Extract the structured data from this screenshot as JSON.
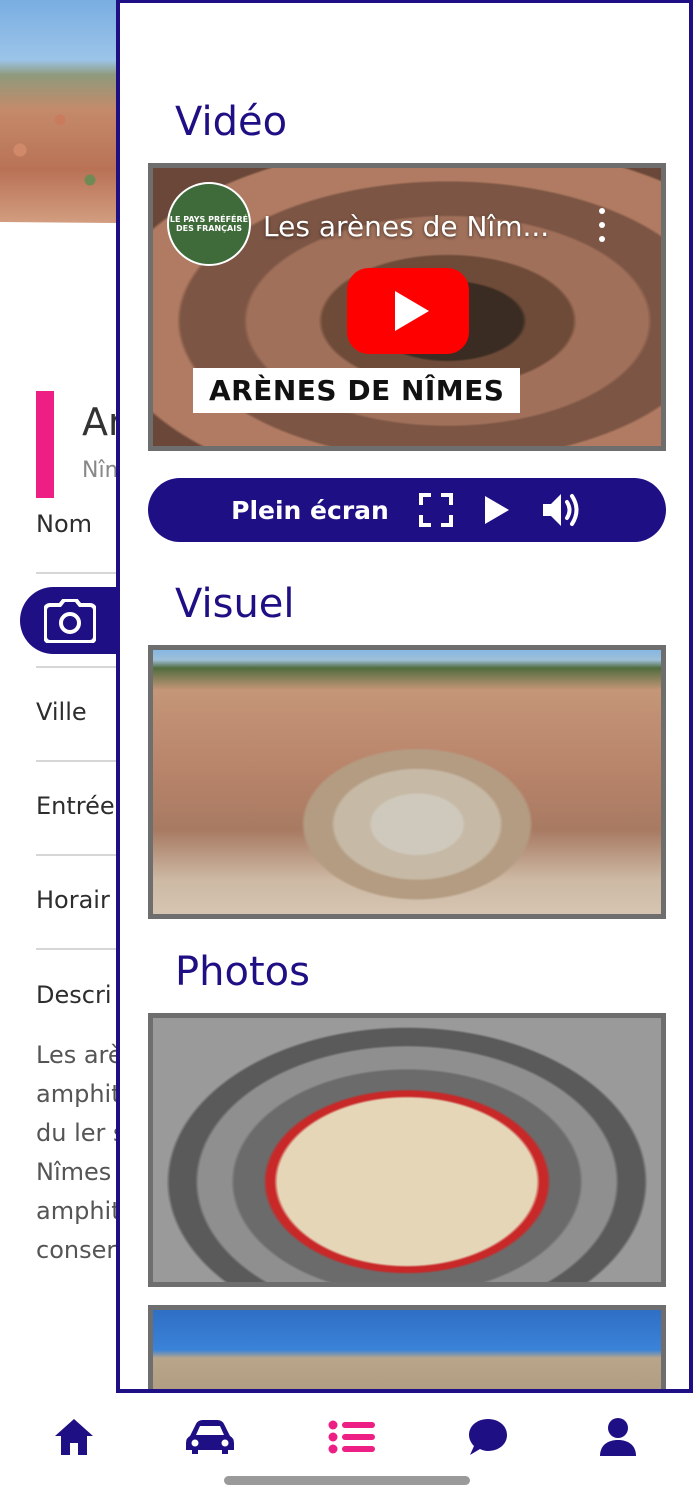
{
  "detail": {
    "title": "Ar",
    "subtitle": "Nîm",
    "fields": {
      "nom": "Nom",
      "ville": "Ville",
      "entree": "Entrée",
      "horaires": "Horair",
      "description": "Descri"
    },
    "description_text": "Les arè\namphit\ndu ler s\nNîmes\namphit\nconser"
  },
  "drawer": {
    "video_section": "Vidéo",
    "visuel_section": "Visuel",
    "photos_section": "Photos",
    "video": {
      "title": "Les arènes de Nîm...",
      "caption": "ARÈNES DE NÎMES",
      "channel_logo_text": "LE PAYS PRÉFÉRÉ DES FRANÇAIS"
    },
    "controls": {
      "fullscreen_label": "Plein écran"
    }
  },
  "colors": {
    "primary": "#1f0f85",
    "accent": "#ee1f84",
    "youtube_red": "#ff0000"
  },
  "bottom_nav": {
    "items": [
      {
        "icon": "home-icon",
        "active": false
      },
      {
        "icon": "car-icon",
        "active": false
      },
      {
        "icon": "list-icon",
        "active": true
      },
      {
        "icon": "chat-icon",
        "active": false
      },
      {
        "icon": "user-icon",
        "active": false
      }
    ]
  }
}
